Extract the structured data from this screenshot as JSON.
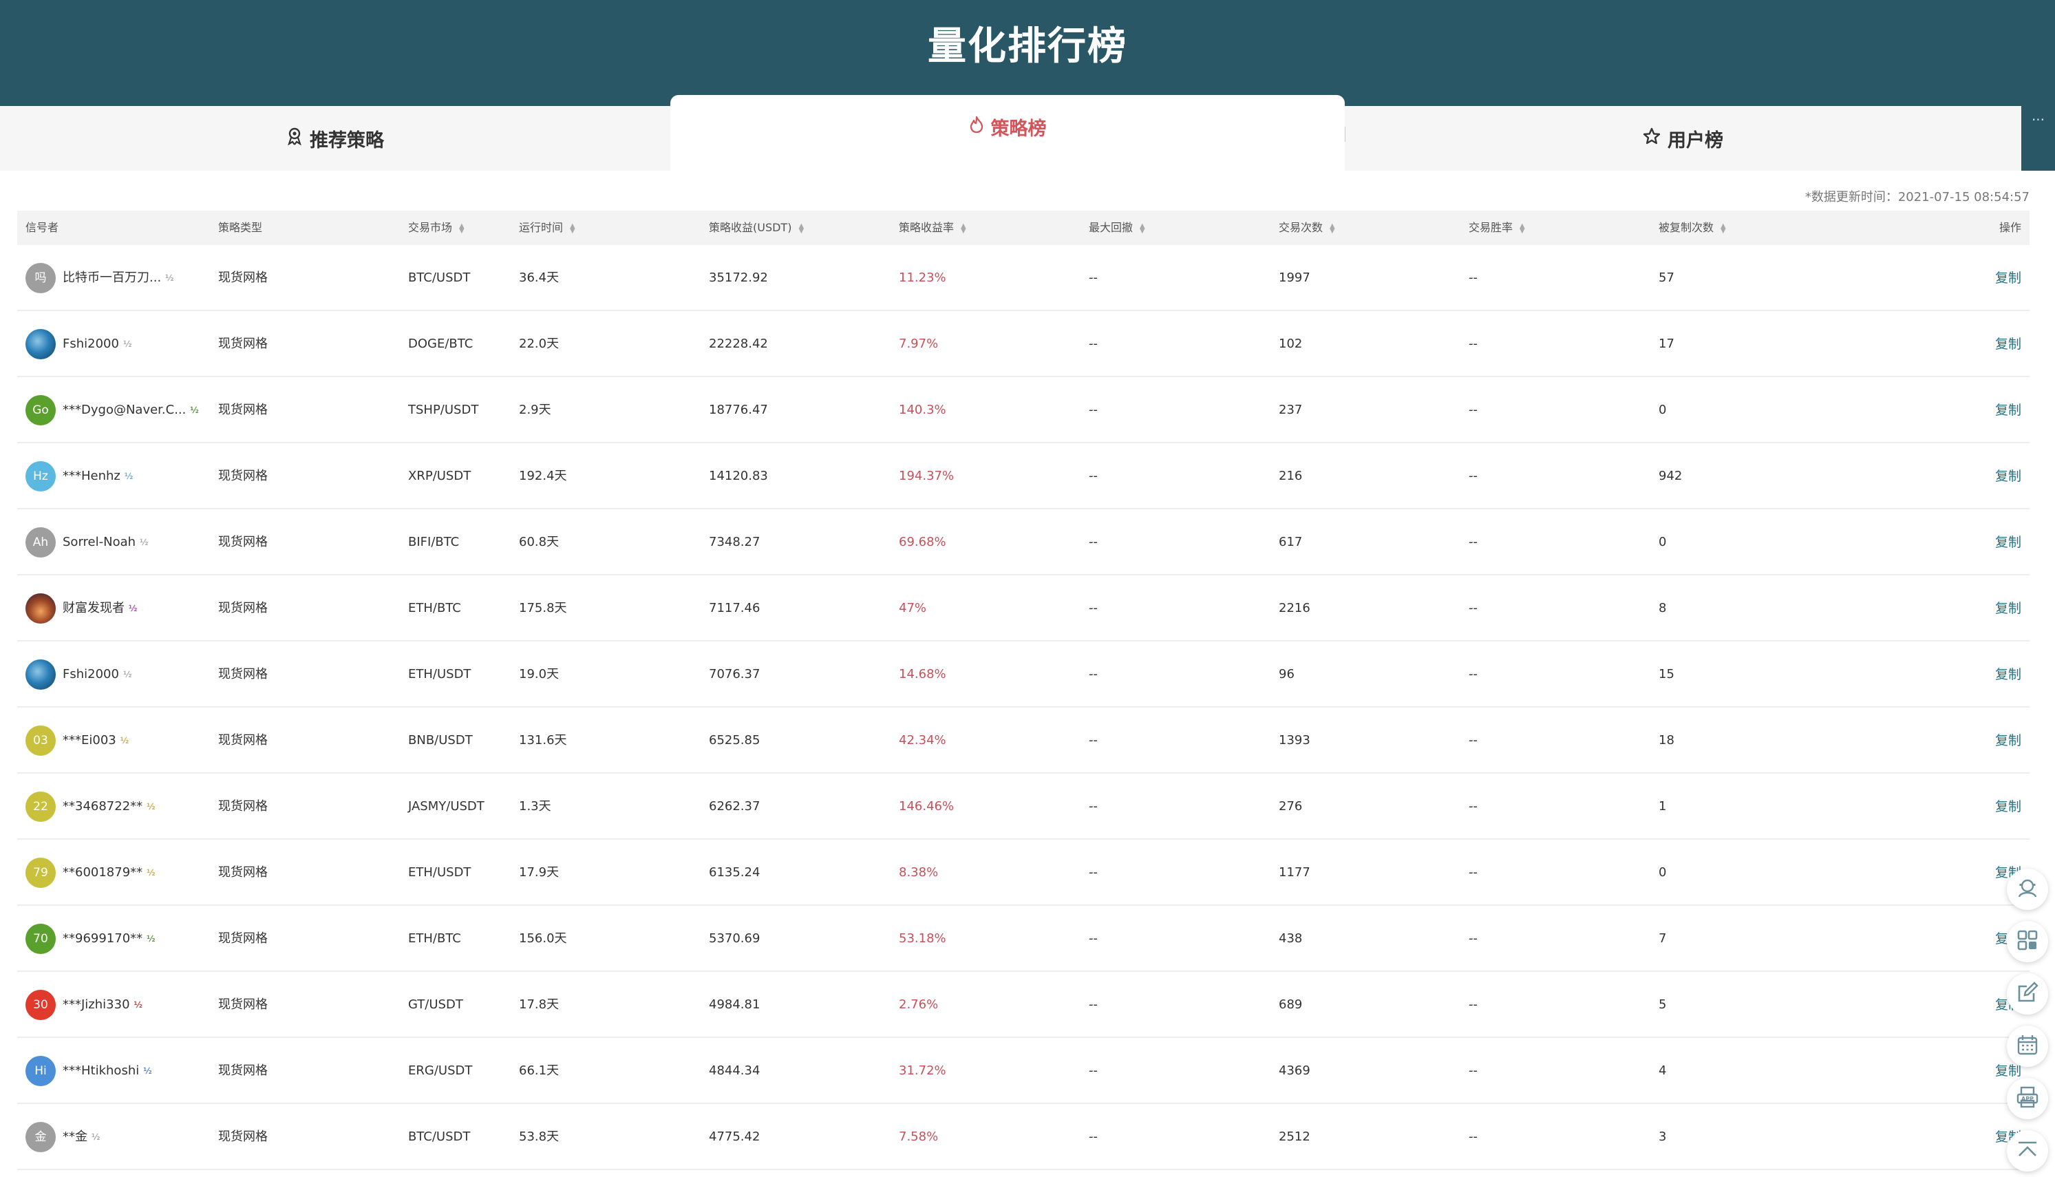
{
  "header": {
    "title": "量化排行榜"
  },
  "tabs": {
    "recommended": "推荐策略",
    "strategy": "策略榜",
    "users": "用户榜",
    "more": "···"
  },
  "update_time": "*数据更新时间：2021-07-15 08:54:57",
  "columns": [
    "信号者",
    "策略类型",
    "交易市场",
    "运行时间",
    "策略收益(USDT)",
    "策略收益率",
    "最大回撤",
    "交易次数",
    "交易胜率",
    "被复制次数",
    "操作"
  ],
  "rows": [
    {
      "avatar_text": "吗",
      "avatar_color": "#9e9e9e",
      "name": "比特币一百万刀...",
      "badge_color": "#aaaaaa",
      "type": "现货网格",
      "market": "BTC/USDT",
      "runtime": "36.4天",
      "profit": "35172.92",
      "rate": "11.23%",
      "drawdown": "--",
      "trades": "1997",
      "winrate": "--",
      "copies": "57",
      "action": "复制"
    },
    {
      "avatar_text": "",
      "avatar_color": "photo",
      "name": "Fshi2000",
      "badge_color": "#aaaaaa",
      "type": "现货网格",
      "market": "DOGE/BTC",
      "runtime": "22.0天",
      "profit": "22228.42",
      "rate": "7.97%",
      "drawdown": "--",
      "trades": "102",
      "winrate": "--",
      "copies": "17",
      "action": "复制"
    },
    {
      "avatar_text": "Go",
      "avatar_color": "#5aa02c",
      "name": "***Dygo@Naver.C...",
      "badge_color": "#5aa02c",
      "type": "现货网格",
      "market": "TSHP/USDT",
      "runtime": "2.9天",
      "profit": "18776.47",
      "rate": "140.3%",
      "drawdown": "--",
      "trades": "237",
      "winrate": "--",
      "copies": "0",
      "action": "复制"
    },
    {
      "avatar_text": "Hz",
      "avatar_color": "#5bb8e0",
      "name": "***Henhz",
      "badge_color": "#5bb8e0",
      "type": "现货网格",
      "market": "XRP/USDT",
      "runtime": "192.4天",
      "profit": "14120.83",
      "rate": "194.37%",
      "drawdown": "--",
      "trades": "216",
      "winrate": "--",
      "copies": "942",
      "action": "复制"
    },
    {
      "avatar_text": "Ah",
      "avatar_color": "#9e9e9e",
      "name": "Sorrel-Noah",
      "badge_color": "#aaaaaa",
      "type": "现货网格",
      "market": "BIFI/BTC",
      "runtime": "60.8天",
      "profit": "7348.27",
      "rate": "69.68%",
      "drawdown": "--",
      "trades": "617",
      "winrate": "--",
      "copies": "0",
      "action": "复制"
    },
    {
      "avatar_text": "",
      "avatar_color": "photo2",
      "name": "财富发现者",
      "badge_color": "#c43bd6",
      "type": "现货网格",
      "market": "ETH/BTC",
      "runtime": "175.8天",
      "profit": "7117.46",
      "rate": "47%",
      "drawdown": "--",
      "trades": "2216",
      "winrate": "--",
      "copies": "8",
      "action": "复制"
    },
    {
      "avatar_text": "",
      "avatar_color": "photo",
      "name": "Fshi2000",
      "badge_color": "#aaaaaa",
      "type": "现货网格",
      "market": "ETH/USDT",
      "runtime": "19.0天",
      "profit": "7076.37",
      "rate": "14.68%",
      "drawdown": "--",
      "trades": "96",
      "winrate": "--",
      "copies": "15",
      "action": "复制"
    },
    {
      "avatar_text": "03",
      "avatar_color": "#c9c13c",
      "name": "***Ei003",
      "badge_color": "#d6b02a",
      "type": "现货网格",
      "market": "BNB/USDT",
      "runtime": "131.6天",
      "profit": "6525.85",
      "rate": "42.34%",
      "drawdown": "--",
      "trades": "1393",
      "winrate": "--",
      "copies": "18",
      "action": "复制"
    },
    {
      "avatar_text": "22",
      "avatar_color": "#c9c13c",
      "name": "**3468722**",
      "badge_color": "#d6b02a",
      "type": "现货网格",
      "market": "JASMY/USDT",
      "runtime": "1.3天",
      "profit": "6262.37",
      "rate": "146.46%",
      "drawdown": "--",
      "trades": "276",
      "winrate": "--",
      "copies": "1",
      "action": "复制"
    },
    {
      "avatar_text": "79",
      "avatar_color": "#c9c13c",
      "name": "**6001879**",
      "badge_color": "#d6b02a",
      "type": "现货网格",
      "market": "ETH/USDT",
      "runtime": "17.9天",
      "profit": "6135.24",
      "rate": "8.38%",
      "drawdown": "--",
      "trades": "1177",
      "winrate": "--",
      "copies": "0",
      "action": "复制"
    },
    {
      "avatar_text": "70",
      "avatar_color": "#5aa02c",
      "name": "**9699170**",
      "badge_color": "#5aa02c",
      "type": "现货网格",
      "market": "ETH/BTC",
      "runtime": "156.0天",
      "profit": "5370.69",
      "rate": "53.18%",
      "drawdown": "--",
      "trades": "438",
      "winrate": "--",
      "copies": "7",
      "action": "复制"
    },
    {
      "avatar_text": "30",
      "avatar_color": "#e03a2c",
      "name": "***Jizhi330",
      "badge_color": "#e03a2c",
      "type": "现货网格",
      "market": "GT/USDT",
      "runtime": "17.8天",
      "profit": "4984.81",
      "rate": "2.76%",
      "drawdown": "--",
      "trades": "689",
      "winrate": "--",
      "copies": "5",
      "action": "复制"
    },
    {
      "avatar_text": "Hi",
      "avatar_color": "#4a8fd8",
      "name": "***Htikhoshi",
      "badge_color": "#4a8fd8",
      "type": "现货网格",
      "market": "ERG/USDT",
      "runtime": "66.1天",
      "profit": "4844.34",
      "rate": "31.72%",
      "drawdown": "--",
      "trades": "4369",
      "winrate": "--",
      "copies": "4",
      "action": "复制"
    },
    {
      "avatar_text": "金",
      "avatar_color": "#9e9e9e",
      "name": "**金",
      "badge_color": "#aaaaaa",
      "type": "现货网格",
      "market": "BTC/USDT",
      "runtime": "53.8天",
      "profit": "4775.42",
      "rate": "7.58%",
      "drawdown": "--",
      "trades": "2512",
      "winrate": "--",
      "copies": "3",
      "action": "复制"
    }
  ],
  "side_tools": [
    "support-icon",
    "qrcode-icon",
    "edit-icon",
    "calendar-icon",
    "app-download-icon",
    "back-to-top-icon"
  ],
  "colors": {
    "header_bg": "#2a5766",
    "accent_red": "#d2555b",
    "link": "#2a6f84"
  }
}
